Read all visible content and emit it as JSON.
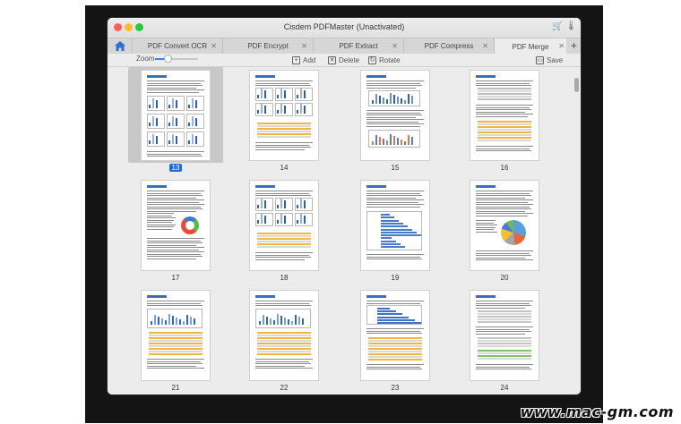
{
  "window": {
    "title": "Cisdem PDFMaster (Unactivated)",
    "icons": [
      "cart-icon",
      "thermometer-icon"
    ]
  },
  "tabs": [
    {
      "label": "PDF Convert OCR",
      "active": false
    },
    {
      "label": "PDF Encrypt",
      "active": false
    },
    {
      "label": "PDF Extract",
      "active": false
    },
    {
      "label": "PDF Compress",
      "active": false
    },
    {
      "label": "PDF Merge",
      "active": true
    }
  ],
  "toolbar": {
    "zoom_label": "Zoom",
    "zoom_level": 0.3,
    "add_label": "Add",
    "delete_label": "Delete",
    "rotate_label": "Rotate",
    "save_label": "Save"
  },
  "pages": [
    {
      "number": "13",
      "selected": true,
      "variant": "charts-grid"
    },
    {
      "number": "14",
      "selected": false,
      "variant": "charts-table"
    },
    {
      "number": "15",
      "selected": false,
      "variant": "text-bars"
    },
    {
      "number": "16",
      "selected": false,
      "variant": "table-yellow"
    },
    {
      "number": "17",
      "selected": false,
      "variant": "text-donut"
    },
    {
      "number": "18",
      "selected": false,
      "variant": "charts-table"
    },
    {
      "number": "19",
      "selected": false,
      "variant": "hbar"
    },
    {
      "number": "20",
      "selected": false,
      "variant": "text-pie"
    },
    {
      "number": "21",
      "selected": false,
      "variant": "bars-table"
    },
    {
      "number": "22",
      "selected": false,
      "variant": "bars-table"
    },
    {
      "number": "23",
      "selected": false,
      "variant": "hbar-table"
    },
    {
      "number": "24",
      "selected": false,
      "variant": "tables-green"
    }
  ],
  "watermark": "www.mac-gm.com"
}
